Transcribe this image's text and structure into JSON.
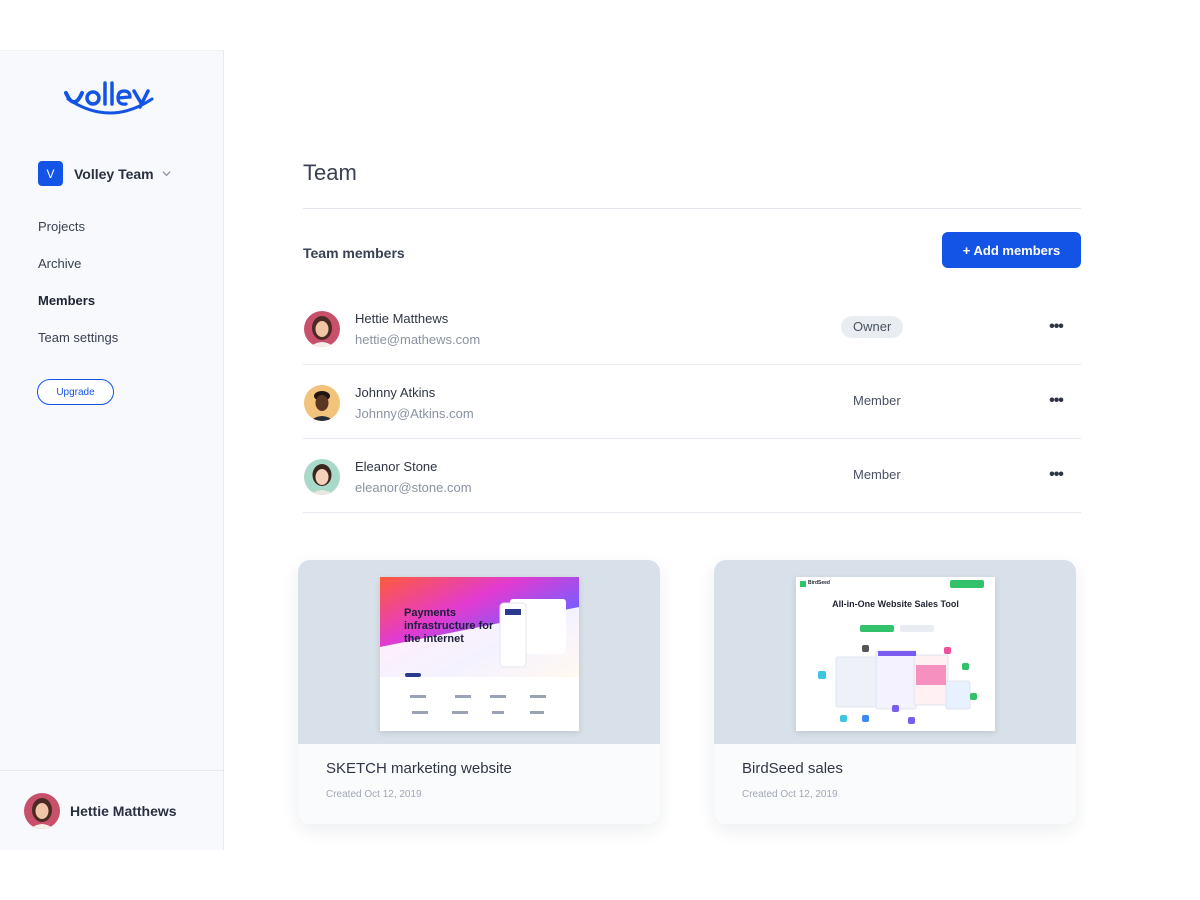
{
  "app": {
    "logo_text": "volley",
    "brand_color": "#1354e6"
  },
  "sidebar": {
    "team_initial": "V",
    "team_name": "Volley Team",
    "items": [
      {
        "label": "Projects",
        "active": false
      },
      {
        "label": "Archive",
        "active": false
      },
      {
        "label": "Members",
        "active": true
      },
      {
        "label": "Team settings",
        "active": false
      }
    ],
    "upgrade_label": "Upgrade",
    "current_user": "Hettie Matthews"
  },
  "main": {
    "title": "Team",
    "section_title": "Team members",
    "add_button_label": "+ Add members",
    "members": [
      {
        "name": "Hettie Matthews",
        "email": "hettie@mathews.com",
        "role": "Owner",
        "more_icon": "more-horizontal-icon"
      },
      {
        "name": "Johnny Atkins",
        "email": "Johnny@Atkins.com",
        "role": "Member",
        "more_icon": "more-horizontal-icon"
      },
      {
        "name": "Eleanor Stone",
        "email": "eleanor@stone.com",
        "role": "Member",
        "more_icon": "more-horizontal-icon"
      }
    ],
    "projects": [
      {
        "title": "SKETCH marketing website",
        "created": "Created Oct 12, 2019",
        "thumb_headline": "Payments infrastructure for the internet"
      },
      {
        "title": "BirdSeed sales",
        "created": "Created Oct 12, 2019",
        "thumb_headline": "All-in-One Website Sales Tool",
        "thumb_brand": "BirdSeed"
      }
    ]
  }
}
